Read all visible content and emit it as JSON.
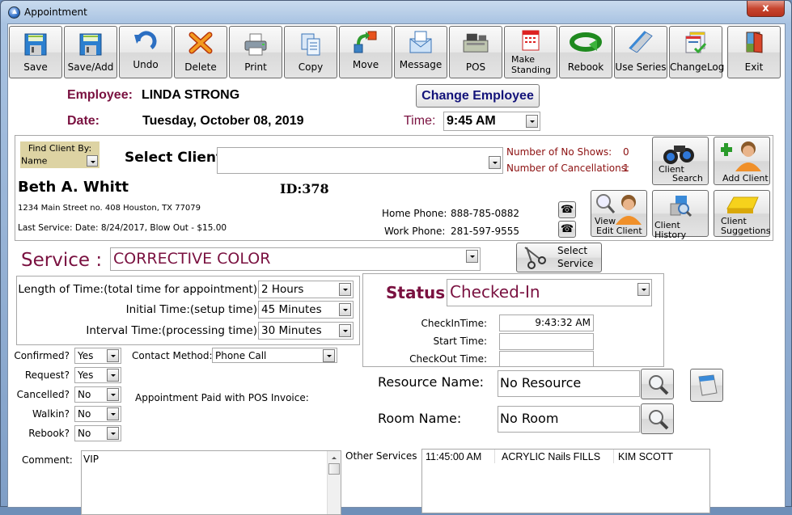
{
  "window": {
    "title": "Appointment",
    "close_label": "x"
  },
  "toolbar": [
    {
      "label": "Save",
      "icon": "save-icon"
    },
    {
      "label": "Save/Add",
      "icon": "save-add-icon"
    },
    {
      "label": "Undo",
      "icon": "undo-icon"
    },
    {
      "label": "Delete",
      "icon": "delete-icon"
    },
    {
      "label": "Print",
      "icon": "printer-icon"
    },
    {
      "label": "Copy",
      "icon": "copy-icon"
    },
    {
      "label": "Move",
      "icon": "move-icon"
    },
    {
      "label": "Message",
      "icon": "message-icon"
    },
    {
      "label": "POS",
      "icon": "cash-register-icon"
    },
    {
      "label": "Make Standing",
      "icon": "calendar-icon"
    },
    {
      "label": "Rebook",
      "icon": "rebook-icon"
    },
    {
      "label": "Use Series",
      "icon": "book-icon"
    },
    {
      "label": "ChangeLog",
      "icon": "changelog-icon"
    },
    {
      "label": "Exit",
      "icon": "exit-door-icon"
    }
  ],
  "header": {
    "employee_label": "Employee:",
    "employee_value": "LINDA STRONG",
    "date_label": "Date:",
    "date_value": "Tuesday, October 08, 2019",
    "change_employee_label": "Change Employee",
    "time_label": "Time:",
    "time_value": "9:45 AM"
  },
  "client": {
    "find_by_label": "Find Client By:",
    "find_by_value": "Name",
    "select_client_label": "Select Client:",
    "select_client_value": "",
    "no_shows_label": "Number of No Shows:",
    "no_shows_value": "0",
    "cancellations_label": "Number of Cancellations:",
    "cancellations_value": "1",
    "name": "Beth A. Whitt",
    "id": "ID:378",
    "address": "1234 Main Street no. 408 Houston, TX 77079",
    "last_service": "Last Service:  Date: 8/24/2017, Blow Out - $15.00",
    "home_phone_label": "Home Phone:",
    "home_phone_value": "888-785-0882",
    "work_phone_label": "Work Phone:",
    "work_phone_value": "281-597-9555",
    "buttons": {
      "client_search_line1": "Client",
      "client_search_line2": "Search",
      "add_client": "Add Client",
      "view_line1": "View",
      "view_line2": "Edit Client",
      "client_history": "Client History",
      "suggestions_line1": "Client",
      "suggestions_line2": "Suggetions"
    }
  },
  "service": {
    "label": "Service :",
    "value": "CORRECTIVE COLOR",
    "select_line1": "Select",
    "select_line2": "Service",
    "length_label": "Length of Time:(total time for appointment)",
    "length_value": "2 Hours",
    "initial_label": "Initial Time:(setup time)",
    "initial_value": "45 Minutes",
    "interval_label": "Interval Time:(processing time)",
    "interval_value": "30 Minutes"
  },
  "status": {
    "label": "Status:",
    "value": "Checked-In",
    "checkin_label": "CheckInTime:",
    "checkin_value": "9:43:32 AM",
    "start_label": "Start Time:",
    "start_value": "",
    "checkout_label": "CheckOut Time:",
    "checkout_value": ""
  },
  "flags": {
    "confirmed_label": "Confirmed?",
    "confirmed_value": "Yes",
    "request_label": "Request?",
    "request_value": "Yes",
    "cancelled_label": "Cancelled?",
    "cancelled_value": "No",
    "walkin_label": "Walkin?",
    "walkin_value": "No",
    "rebook_label": "Rebook?",
    "rebook_value": "No",
    "contact_label": "Contact Method:",
    "contact_value": "Phone Call",
    "paid_label": "Appointment Paid with POS Invoice:"
  },
  "resource": {
    "resource_label": "Resource Name:",
    "resource_value": "No Resource",
    "room_label": "Room Name:",
    "room_value": "No Room"
  },
  "comment": {
    "label": "Comment:",
    "value": "VIP"
  },
  "other_services": {
    "label": "Other Services",
    "rows": [
      {
        "time": "11:45:00 AM",
        "service": "ACRYLIC Nails FILLS",
        "employee": "KIM SCOTT"
      }
    ]
  }
}
